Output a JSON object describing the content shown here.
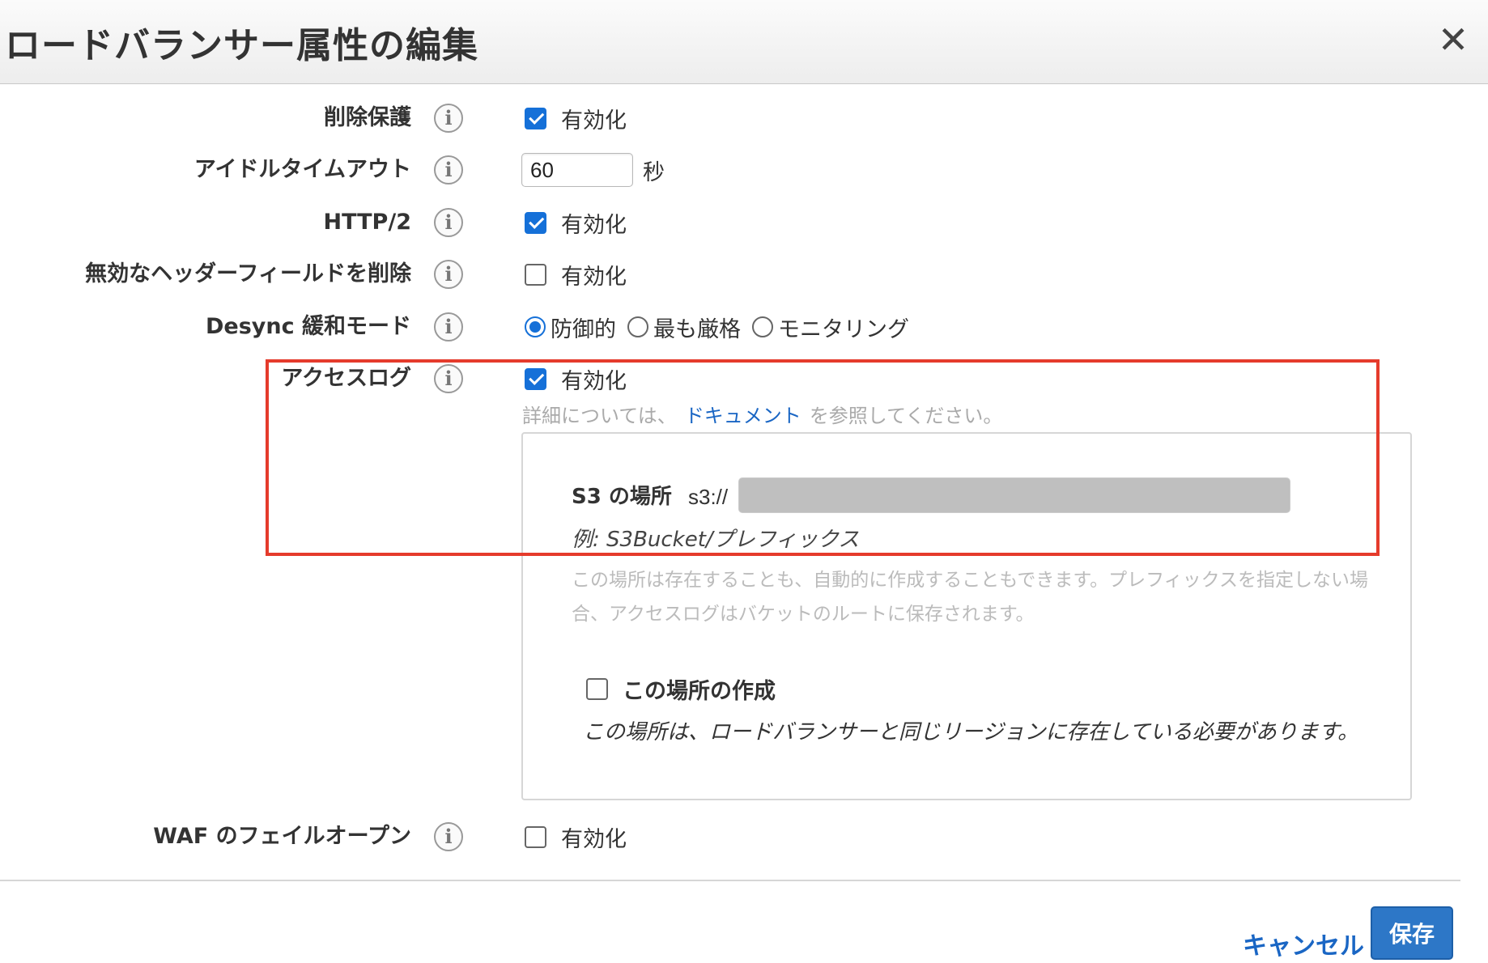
{
  "dialog": {
    "title": "ロードバランサー属性の編集",
    "close_label": "✕"
  },
  "attributes": {
    "deletion_protection": {
      "label": "削除保護",
      "option_label": "有効化",
      "checked": true
    },
    "idle_timeout": {
      "label": "アイドルタイムアウト",
      "value": "60",
      "unit": "秒"
    },
    "http2": {
      "label": "HTTP/2",
      "option_label": "有効化",
      "checked": true
    },
    "drop_invalid_headers": {
      "label": "無効なヘッダーフィールドを削除",
      "option_label": "有効化",
      "checked": false
    },
    "desync": {
      "label": "Desync 緩和モード",
      "options": [
        "防御的",
        "最も厳格",
        "モニタリング"
      ],
      "selected": "防御的"
    },
    "access_logs": {
      "label": "アクセスログ",
      "option_label": "有効化",
      "checked": true,
      "help_prefix": "詳細については、",
      "help_link": "ドキュメント",
      "help_suffix": "を参照してください。",
      "s3": {
        "label": "S3 の場所",
        "prefix": "s3://",
        "example": "例: S3Bucket/プレフィックス",
        "description": "この場所は存在することも、自動的に作成することもできます。プレフィックスを指定しない場合、アクセスログはバケットのルートに保存されます。",
        "create_label": "この場所の作成",
        "create_checked": false,
        "create_note": "この場所は、ロードバランサーと同じリージョンに存在している必要があります。"
      }
    },
    "waf_fail_open": {
      "label": "WAF のフェイルオープン",
      "option_label": "有効化",
      "checked": false
    }
  },
  "footer": {
    "cancel_label": "キャンセル",
    "save_label": "保存"
  },
  "colors": {
    "accent": "#1570d8",
    "link": "#1a66c4",
    "highlight": "#e53b2c",
    "save_button": "#2d77c7"
  },
  "icons": {
    "info": "info-icon",
    "close": "close-icon"
  }
}
